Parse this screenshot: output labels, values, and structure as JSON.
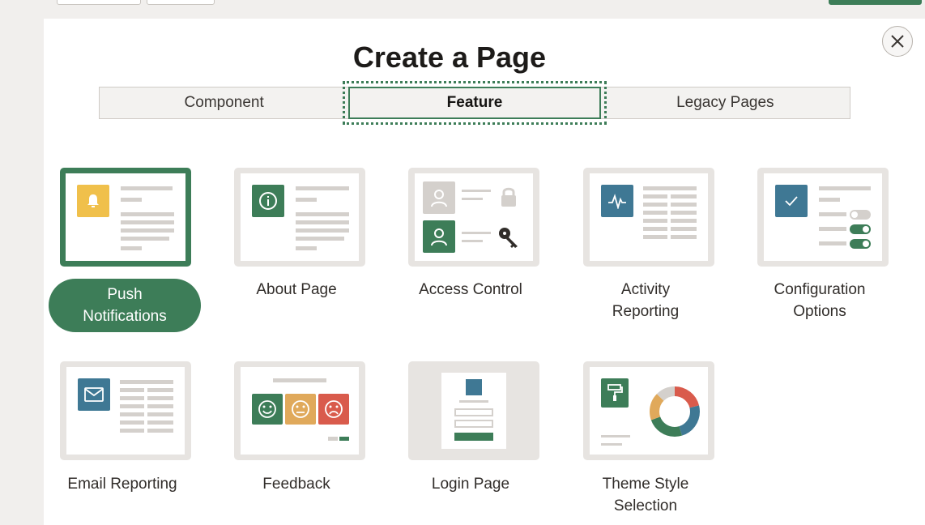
{
  "dialog": {
    "title": "Create a Page",
    "close_label": "×"
  },
  "tabs": [
    {
      "label": "Component",
      "active": false
    },
    {
      "label": "Feature",
      "active": true
    },
    {
      "label": "Legacy Pages",
      "active": false
    }
  ],
  "features": [
    {
      "label_line1": "Push",
      "label_line2": "Notifications",
      "selected": true,
      "icon": "bell-icon"
    },
    {
      "label_line1": "About Page",
      "label_line2": "",
      "selected": false,
      "icon": "info-icon"
    },
    {
      "label_line1": "Access Control",
      "label_line2": "",
      "selected": false,
      "icon": "user-icon"
    },
    {
      "label_line1": "Activity",
      "label_line2": "Reporting",
      "selected": false,
      "icon": "activity-icon"
    },
    {
      "label_line1": "Configuration",
      "label_line2": "Options",
      "selected": false,
      "icon": "check-icon"
    },
    {
      "label_line1": "Email Reporting",
      "label_line2": "",
      "selected": false,
      "icon": "envelope-icon"
    },
    {
      "label_line1": "Feedback",
      "label_line2": "",
      "selected": false,
      "icon": "smiley-icon"
    },
    {
      "label_line1": "Login Page",
      "label_line2": "",
      "selected": false,
      "icon": "login-icon"
    },
    {
      "label_line1": "Theme Style",
      "label_line2": "Selection",
      "selected": false,
      "icon": "paint-roller-icon"
    }
  ],
  "colors": {
    "accent": "#3d7d58",
    "yellow": "#f0c04b",
    "blue": "#3f7894",
    "orange": "#e0a95b",
    "red": "#d95b4c"
  }
}
